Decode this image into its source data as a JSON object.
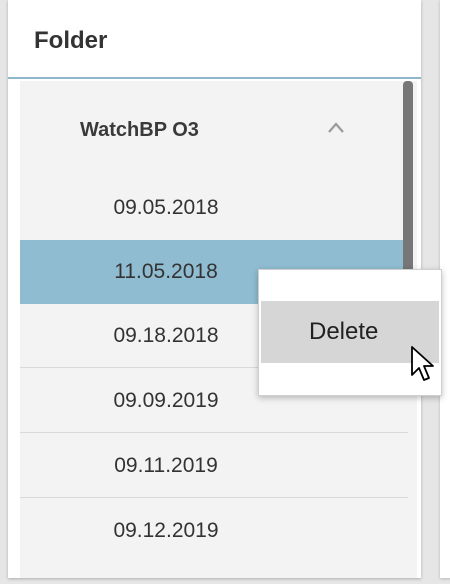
{
  "panel": {
    "title": "Folder"
  },
  "folder": {
    "name": "WatchBP O3",
    "expanded_icon": "chevron-up-icon",
    "items": [
      {
        "date": "09.05.2018",
        "selected": false
      },
      {
        "date": "11.05.2018",
        "selected": true
      },
      {
        "date": "09.18.2018",
        "selected": false
      },
      {
        "date": "09.09.2019",
        "selected": false
      },
      {
        "date": "09.11.2019",
        "selected": false
      },
      {
        "date": "09.12.2019",
        "selected": false
      }
    ]
  },
  "context_menu": {
    "items": [
      {
        "label": "Delete",
        "hovered": true
      }
    ]
  },
  "colors": {
    "selected_row": "#8fbcd0",
    "header_divider": "#8fb7cc",
    "menu_hover": "#d6d6d6",
    "scrollbar": "#777777"
  },
  "cursor": "arrow-pointer-icon"
}
